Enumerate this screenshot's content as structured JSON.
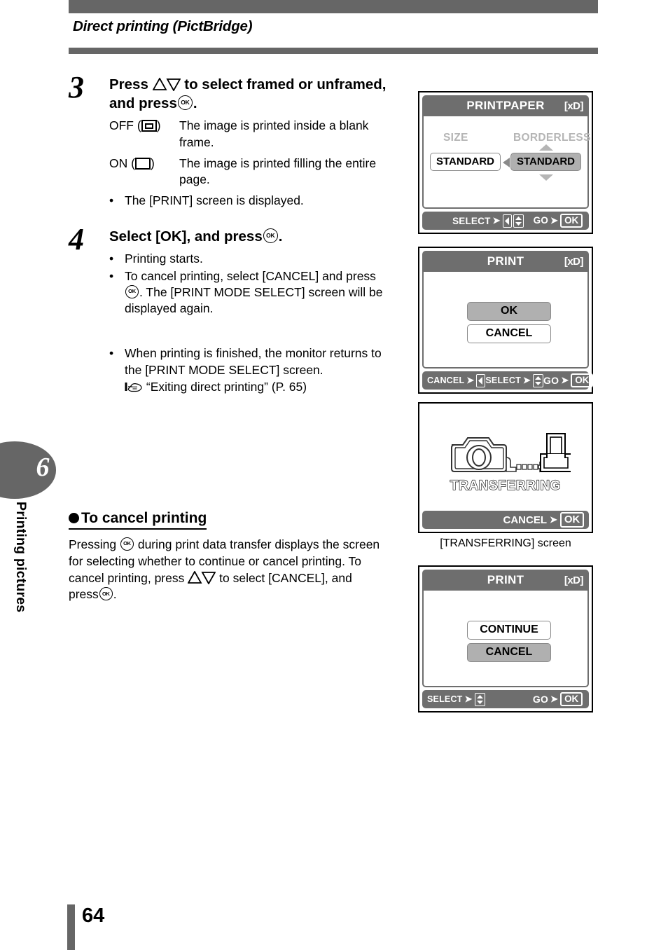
{
  "header": {
    "title": "Direct printing (PictBridge)"
  },
  "side_tab": {
    "chapter_number": "6",
    "chapter_label": "Printing pictures"
  },
  "footer": {
    "page_number": "64"
  },
  "steps": [
    {
      "number": "3",
      "title_part1": "Press",
      "title_part2": "to select framed or unframed, and press",
      "title_part3": ".",
      "definitions": [
        {
          "term": "OFF",
          "icon": "frame-off-icon",
          "desc": "The image is printed inside a blank frame."
        },
        {
          "term": "ON",
          "icon": "frame-on-icon",
          "desc": "The image is printed filling the entire page."
        }
      ],
      "bullets": [
        "The [PRINT] screen is displayed."
      ]
    },
    {
      "number": "4",
      "title_part1": "Select [OK], and press",
      "title_part3": ".",
      "bullets": [
        "Printing starts.",
        "To cancel printing, select [CANCEL] and press",
        "When printing is finished, the monitor returns to the [PRINT MODE SELECT] screen."
      ],
      "bullet2_tail": ". The [PRINT MODE SELECT] screen will be displayed again.",
      "reference": "“Exiting direct printing” (P. 65)"
    }
  ],
  "section": {
    "heading": "To cancel printing",
    "body_part1": "Pressing",
    "body_part2": "during print data transfer displays the screen for selecting whether to continue or cancel printing. To cancel printing, press",
    "body_part3": "to select [CANCEL], and press",
    "body_part4": "."
  },
  "screens": [
    {
      "id": "printpaper",
      "title": "PRINTPAPER",
      "media_badge": "xD",
      "label_left": "SIZE",
      "label_right": "BORDERLESS",
      "button_left": "STANDARD",
      "button_right": "STANDARD",
      "selected": "button_right",
      "footer": [
        {
          "label": "SELECT",
          "keys": [
            "left-right-key",
            "up-down-key"
          ]
        },
        {
          "label": "GO",
          "keys": [
            "ok-key"
          ]
        }
      ]
    },
    {
      "id": "print-ok",
      "title": "PRINT",
      "media_badge": "xD",
      "buttons": [
        "OK",
        "CANCEL"
      ],
      "selected_index": 0,
      "footer": [
        {
          "label": "CANCEL",
          "keys": [
            "left-key"
          ]
        },
        {
          "label": "SELECT",
          "keys": [
            "up-down-key"
          ]
        },
        {
          "label": "GO",
          "keys": [
            "ok-key"
          ]
        }
      ]
    },
    {
      "id": "transferring",
      "status_text": "TRANSFERRING",
      "caption": "[TRANSFERRING] screen",
      "footer": [
        {
          "label": "CANCEL",
          "keys": [
            "ok-key"
          ]
        }
      ]
    },
    {
      "id": "print-continue",
      "title": "PRINT",
      "media_badge": "xD",
      "buttons": [
        "CONTINUE",
        "CANCEL"
      ],
      "selected_index": 1,
      "footer": [
        {
          "label": "SELECT",
          "keys": [
            "up-down-key"
          ]
        },
        {
          "label": "GO",
          "keys": [
            "ok-key"
          ]
        }
      ]
    }
  ],
  "keys": {
    "ok_label": "OK"
  },
  "colors": {
    "bar_gray": "#666666",
    "screen_chrome": "#6e6e6e",
    "highlight": "#b0b0b0",
    "dim_label": "#b5b5b5"
  }
}
